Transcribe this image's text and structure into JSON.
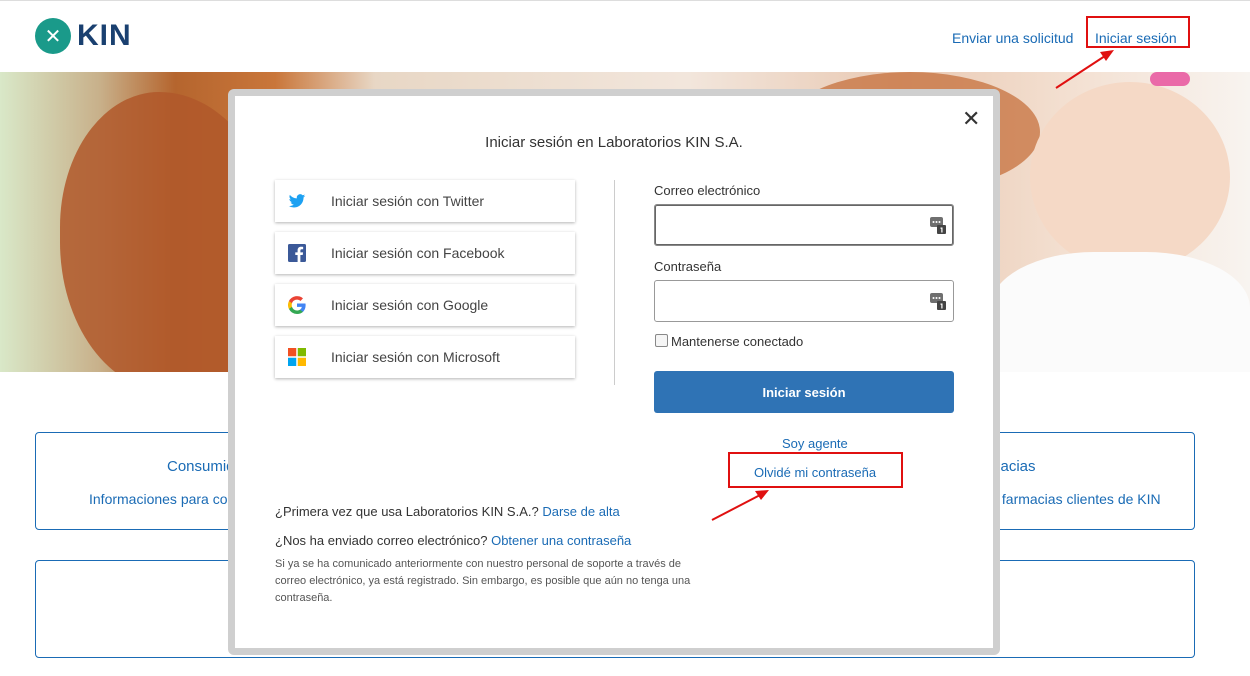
{
  "header": {
    "logo_text": "KIN",
    "logo_mark": "✕",
    "nav_request": "Enviar una solicitud",
    "nav_login": "Iniciar sesión"
  },
  "cards": {
    "card1_title": "Consumid",
    "card1_sub": "Informaciones para con",
    "card2_title": "macias",
    "card2_sub": "s farmacias clientes de KIN"
  },
  "modal": {
    "close": "✕",
    "title": "Iniciar sesión en Laboratorios KIN S.A.",
    "social": {
      "twitter": "Iniciar sesión con Twitter",
      "facebook": "Iniciar sesión con Facebook",
      "google": "Iniciar sesión con Google",
      "microsoft": "Iniciar sesión con Microsoft"
    },
    "email_label": "Correo electrónico",
    "email_value": "",
    "password_label": "Contraseña",
    "password_value": "",
    "remember_label": "Mantenerse conectado",
    "submit_label": "Iniciar sesión",
    "agent_link": "Soy agente",
    "forgot_link": "Olvidé mi contraseña",
    "first_time_text": "¿Primera vez que usa Laboratorios KIN S.A.?",
    "signup_link": "Darse de alta",
    "sent_email_text": "¿Nos ha enviado correo electrónico?",
    "get_password_link": "Obtener una contraseña",
    "note": "Si ya se ha comunicado anteriormente con nuestro personal de soporte a través de correo electrónico, ya está registrado. Sin embargo, es posible que aún no tenga una contraseña."
  },
  "colors": {
    "link": "#1a6bb5",
    "primary_button": "#2f73b5",
    "annotation": "#e01010",
    "logo_teal": "#1a9a8a",
    "logo_navy": "#1a4070"
  },
  "icons": [
    "twitter-icon",
    "facebook-icon",
    "google-icon",
    "microsoft-icon",
    "close-icon",
    "password-manager-icon"
  ]
}
